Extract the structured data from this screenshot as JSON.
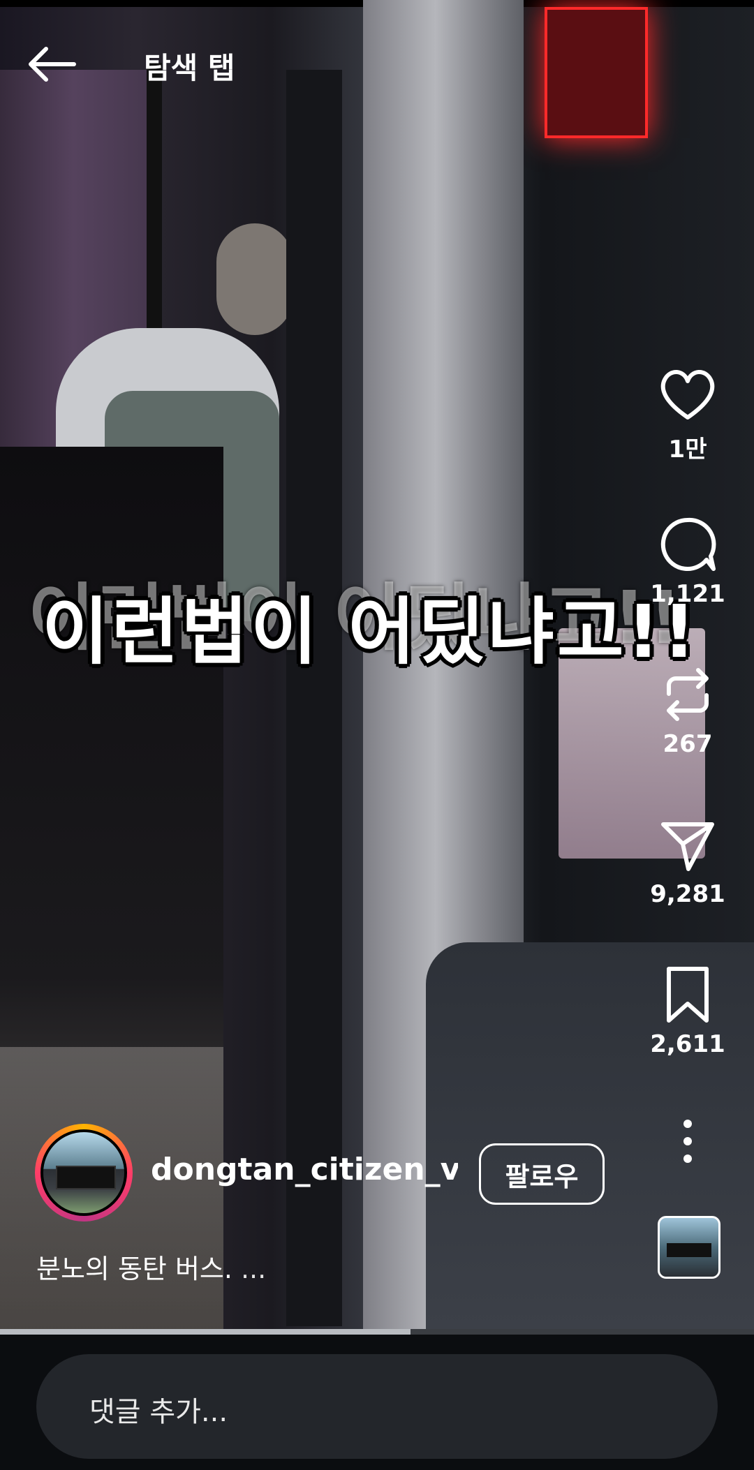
{
  "header": {
    "title": "탐색 탭"
  },
  "overlay_caption": "이런법이 어딨냐고!!",
  "actions": {
    "like": {
      "icon": "heart-icon",
      "count": "1만"
    },
    "comment": {
      "icon": "comment-bubble-icon",
      "count": "1,121"
    },
    "repost": {
      "icon": "repost-icon",
      "count": "267"
    },
    "share": {
      "icon": "send-icon",
      "count": "9,281"
    },
    "save": {
      "icon": "bookmark-icon",
      "count": "2,611"
    },
    "more": {
      "icon": "more-vertical-icon"
    }
  },
  "author": {
    "username": "dongtan_citizen_v...",
    "follow_label": "팔로우"
  },
  "description": {
    "text": "분노의 동탄 버스.",
    "more": "..."
  },
  "progress": {
    "fraction": 0.544
  },
  "comment": {
    "placeholder": "댓글 추가..."
  },
  "colors": {
    "background": "#0b0d10",
    "comment_bar": "#23262b",
    "progress_fill": "#b9bcc1",
    "progress_track": "#3a3d42"
  }
}
